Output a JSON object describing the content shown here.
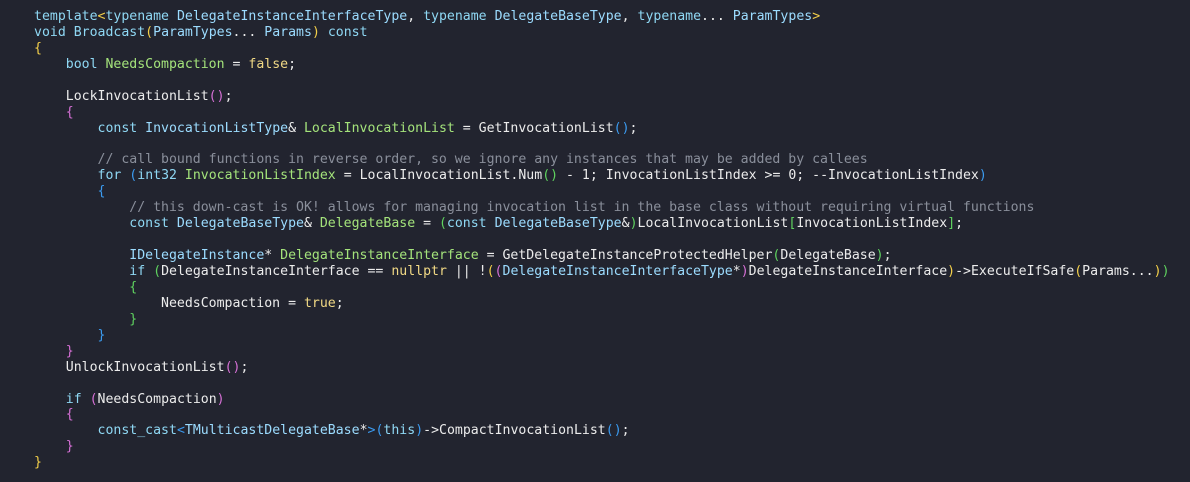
{
  "editor": {
    "language": "C++",
    "theme_colors": {
      "background": "#22242f",
      "keyword": "#8fd8f4",
      "type": "#9cdcff",
      "variable": "#a4e37b",
      "literal": "#f1d985",
      "comment": "#8a8f9b",
      "text": "#ececec",
      "bracket_1": "#f4d04a",
      "bracket_2": "#d670d6",
      "bracket_3": "#3b9bf0",
      "bracket_4": "#5fd35f"
    },
    "lines": [
      [
        [
          "kw",
          "template"
        ],
        [
          "br1",
          "<"
        ],
        [
          "kw",
          "typename "
        ],
        [
          "type",
          "DelegateInstanceInterfaceType"
        ],
        [
          "id",
          ", "
        ],
        [
          "kw",
          "typename "
        ],
        [
          "type",
          "DelegateBaseType"
        ],
        [
          "id",
          ", "
        ],
        [
          "kw",
          "typename"
        ],
        [
          "id",
          "... "
        ],
        [
          "type",
          "ParamTypes"
        ],
        [
          "br1",
          ">"
        ]
      ],
      [
        [
          "kw",
          "void "
        ],
        [
          "fn",
          "Broadcast"
        ],
        [
          "br1",
          "("
        ],
        [
          "type",
          "ParamTypes"
        ],
        [
          "id",
          "... "
        ],
        [
          "type",
          "Params"
        ],
        [
          "br1",
          ")"
        ],
        [
          "kw",
          " const"
        ]
      ],
      [
        [
          "br1",
          "{"
        ]
      ],
      [
        [
          "id",
          "    "
        ],
        [
          "kw",
          "bool "
        ],
        [
          "var",
          "NeedsCompaction"
        ],
        [
          "id",
          " = "
        ],
        [
          "lit",
          "false"
        ],
        [
          "id",
          ";"
        ]
      ],
      [
        [
          "id",
          ""
        ]
      ],
      [
        [
          "id",
          "    LockInvocationList"
        ],
        [
          "br2",
          "()"
        ],
        [
          "id",
          ";"
        ]
      ],
      [
        [
          "id",
          "    "
        ],
        [
          "br2",
          "{"
        ]
      ],
      [
        [
          "id",
          "        "
        ],
        [
          "kw",
          "const "
        ],
        [
          "type",
          "InvocationListType"
        ],
        [
          "id",
          "& "
        ],
        [
          "var",
          "LocalInvocationList"
        ],
        [
          "id",
          " = GetInvocationList"
        ],
        [
          "br3",
          "()"
        ],
        [
          "id",
          ";"
        ]
      ],
      [
        [
          "id",
          ""
        ]
      ],
      [
        [
          "id",
          "        "
        ],
        [
          "cm",
          "// call bound functions in reverse order, so we ignore any instances that may be added by callees"
        ]
      ],
      [
        [
          "id",
          "        "
        ],
        [
          "kw",
          "for "
        ],
        [
          "br3",
          "("
        ],
        [
          "kw",
          "int32 "
        ],
        [
          "var",
          "InvocationListIndex"
        ],
        [
          "id",
          " = LocalInvocationList.Num"
        ],
        [
          "br4",
          "()"
        ],
        [
          "id",
          " - 1; InvocationListIndex >= 0; --InvocationListIndex"
        ],
        [
          "br3",
          ")"
        ]
      ],
      [
        [
          "id",
          "        "
        ],
        [
          "br3",
          "{"
        ]
      ],
      [
        [
          "id",
          "            "
        ],
        [
          "cm",
          "// this down-cast is OK! allows for managing invocation list in the base class without requiring virtual functions"
        ]
      ],
      [
        [
          "id",
          "            "
        ],
        [
          "kw",
          "const "
        ],
        [
          "type",
          "DelegateBaseType"
        ],
        [
          "id",
          "& "
        ],
        [
          "var",
          "DelegateBase"
        ],
        [
          "id",
          " = "
        ],
        [
          "br4",
          "("
        ],
        [
          "kw",
          "const "
        ],
        [
          "type",
          "DelegateBaseType"
        ],
        [
          "id",
          "&"
        ],
        [
          "br4",
          ")"
        ],
        [
          "id",
          "LocalInvocationList"
        ],
        [
          "br4",
          "["
        ],
        [
          "id",
          "InvocationListIndex"
        ],
        [
          "br4",
          "]"
        ],
        [
          "id",
          ";"
        ]
      ],
      [
        [
          "id",
          ""
        ]
      ],
      [
        [
          "id",
          "            "
        ],
        [
          "type",
          "IDelegateInstance"
        ],
        [
          "id",
          "* "
        ],
        [
          "var",
          "DelegateInstanceInterface"
        ],
        [
          "id",
          " = GetDelegateInstanceProtectedHelper"
        ],
        [
          "br4",
          "("
        ],
        [
          "id",
          "DelegateBase"
        ],
        [
          "br4",
          ")"
        ],
        [
          "id",
          ";"
        ]
      ],
      [
        [
          "id",
          "            "
        ],
        [
          "kw",
          "if "
        ],
        [
          "br4",
          "("
        ],
        [
          "id",
          "DelegateInstanceInterface == "
        ],
        [
          "lit",
          "nullptr"
        ],
        [
          "id",
          " || !"
        ],
        [
          "br1",
          "("
        ],
        [
          "br2",
          "("
        ],
        [
          "type",
          "DelegateInstanceInterfaceType"
        ],
        [
          "id",
          "*"
        ],
        [
          "br2",
          ")"
        ],
        [
          "id",
          "DelegateInstanceInterface"
        ],
        [
          "br1",
          ")"
        ],
        [
          "id",
          "->ExecuteIfSafe"
        ],
        [
          "br1",
          "("
        ],
        [
          "id",
          "Params..."
        ],
        [
          "br1",
          ")"
        ],
        [
          "br4",
          ")"
        ]
      ],
      [
        [
          "id",
          "            "
        ],
        [
          "br4",
          "{"
        ]
      ],
      [
        [
          "id",
          "                NeedsCompaction = "
        ],
        [
          "lit",
          "true"
        ],
        [
          "id",
          ";"
        ]
      ],
      [
        [
          "id",
          "            "
        ],
        [
          "br4",
          "}"
        ]
      ],
      [
        [
          "id",
          "        "
        ],
        [
          "br3",
          "}"
        ]
      ],
      [
        [
          "id",
          "    "
        ],
        [
          "br2",
          "}"
        ]
      ],
      [
        [
          "id",
          "    UnlockInvocationList"
        ],
        [
          "br2",
          "()"
        ],
        [
          "id",
          ";"
        ]
      ],
      [
        [
          "id",
          ""
        ]
      ],
      [
        [
          "id",
          "    "
        ],
        [
          "kw",
          "if "
        ],
        [
          "br2",
          "("
        ],
        [
          "id",
          "NeedsCompaction"
        ],
        [
          "br2",
          ")"
        ]
      ],
      [
        [
          "id",
          "    "
        ],
        [
          "br2",
          "{"
        ]
      ],
      [
        [
          "id",
          "        "
        ],
        [
          "kw",
          "const_cast"
        ],
        [
          "br3",
          "<"
        ],
        [
          "type",
          "TMulticastDelegateBase"
        ],
        [
          "id",
          "*"
        ],
        [
          "br3",
          ">"
        ],
        [
          "br3",
          "("
        ],
        [
          "kw",
          "this"
        ],
        [
          "br3",
          ")"
        ],
        [
          "id",
          "->CompactInvocationList"
        ],
        [
          "br3",
          "()"
        ],
        [
          "id",
          ";"
        ]
      ],
      [
        [
          "id",
          "    "
        ],
        [
          "br2",
          "}"
        ]
      ],
      [
        [
          "br1",
          "}"
        ]
      ]
    ]
  }
}
